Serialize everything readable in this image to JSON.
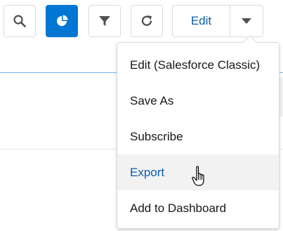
{
  "toolbar": {
    "buttons": [
      {
        "icon": "search-icon",
        "active": false
      },
      {
        "icon": "chart-icon",
        "active": true
      },
      {
        "icon": "filter-icon",
        "active": false
      },
      {
        "icon": "refresh-icon",
        "active": false
      }
    ],
    "edit_label": "Edit",
    "dropdown_icon": "chevron-down-icon",
    "accent": "#0176d3"
  },
  "menu": {
    "items": [
      {
        "label": "Edit (Salesforce Classic)"
      },
      {
        "label": "Save As"
      },
      {
        "label": "Subscribe"
      },
      {
        "label": "Export",
        "hovered": true
      },
      {
        "label": "Add to Dashboard"
      }
    ]
  }
}
